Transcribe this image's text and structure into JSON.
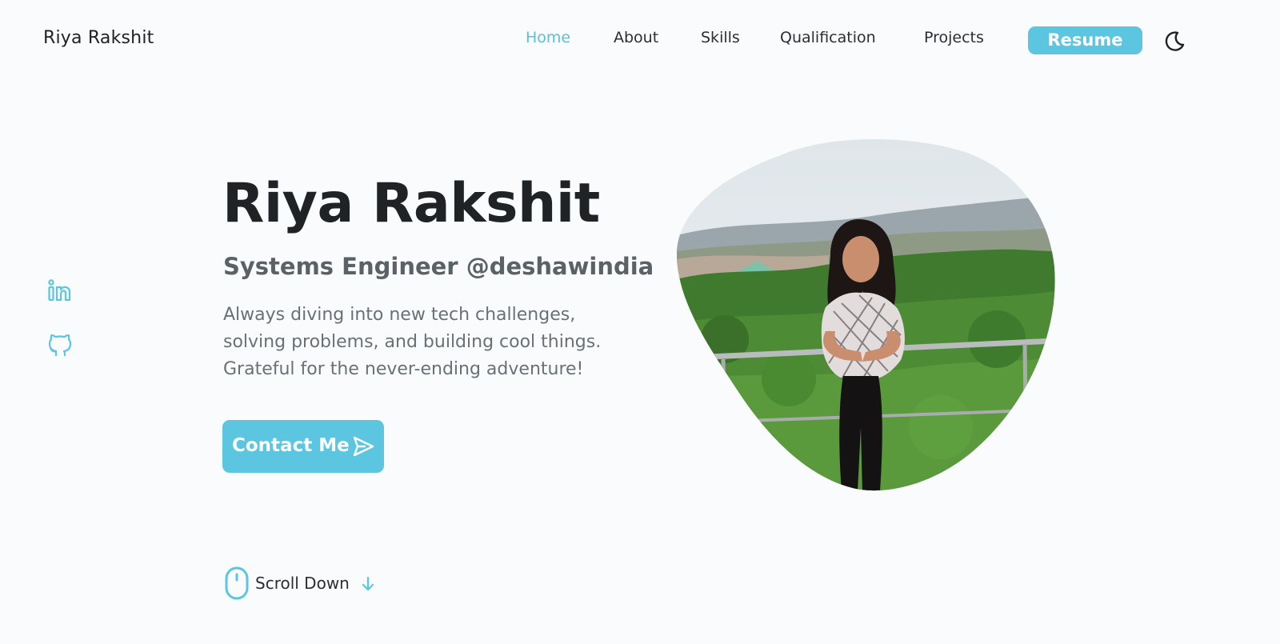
{
  "header": {
    "logo": "Riya Rakshit",
    "nav": [
      {
        "label": "Home",
        "active": true
      },
      {
        "label": "About",
        "active": false
      },
      {
        "label": "Skills",
        "active": false
      },
      {
        "label": "Qualification",
        "active": false
      },
      {
        "label": "Projects",
        "active": false
      }
    ],
    "resume_label": "Resume",
    "theme_icon": "moon-icon"
  },
  "social": [
    {
      "icon": "linkedin-icon"
    },
    {
      "icon": "github-icon"
    }
  ],
  "hero": {
    "title": "Riya Rakshit",
    "subtitle": "Systems Engineer @deshawindia",
    "description": [
      "Always diving into new tech challenges,",
      "solving problems, and building cool things.",
      "Grateful for the never-ending adventure!"
    ],
    "contact_label": "Contact Me",
    "contact_icon": "send-icon"
  },
  "scroll": {
    "label": "Scroll Down",
    "icons": [
      "mouse-icon",
      "arrow-down-icon"
    ]
  },
  "colors": {
    "accent": "#5cc6e0",
    "active_link": "#5cbfdc",
    "background": "#f9fbfc",
    "heading": "#1f2326",
    "muted_text": "#6a7174"
  }
}
